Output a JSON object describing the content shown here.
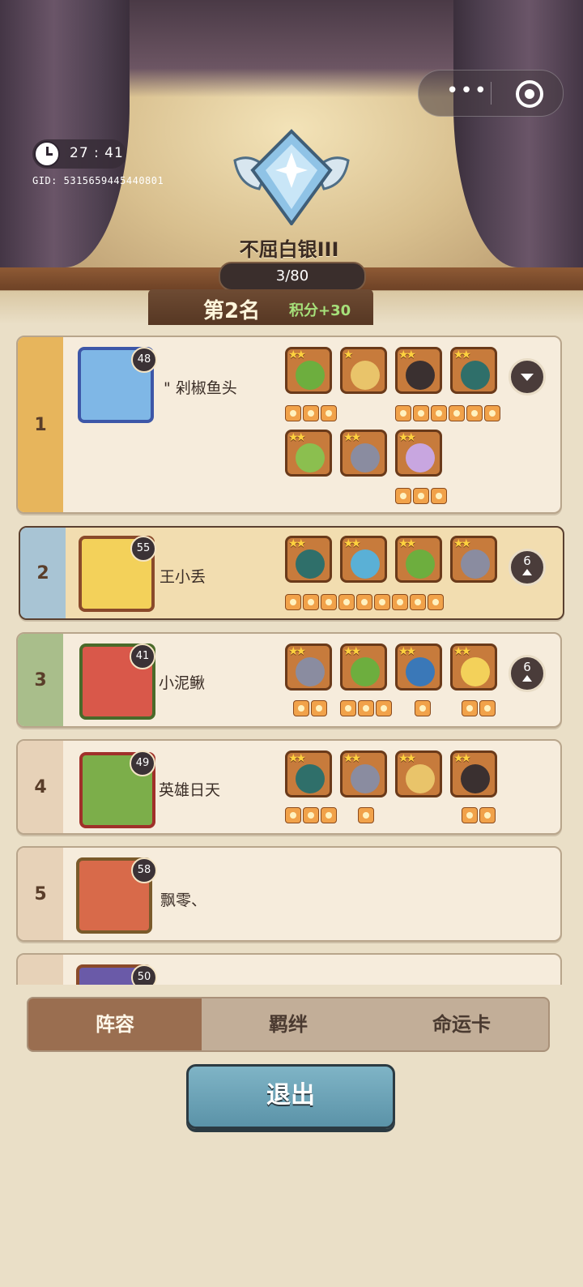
{
  "header": {
    "menu_dots": "•••",
    "timer": "27 : 41",
    "gid": "GID: 5315659445440801",
    "rank_title": "不屈白银III",
    "rank_progress": "3/80",
    "place": "第2名",
    "score": "积分+30"
  },
  "players": [
    {
      "rank": "1",
      "level": "48",
      "name": "\" 剁椒鱼头",
      "avatar_color": "#7fb7e6"
    },
    {
      "rank": "2",
      "level": "55",
      "name": "王小丢",
      "avatar_color": "#f3d15a",
      "expand_count": "6"
    },
    {
      "rank": "3",
      "level": "41",
      "name": "小泥鳅",
      "avatar_color": "#d9584a",
      "expand_count": "6"
    },
    {
      "rank": "4",
      "level": "49",
      "name": "英雄日天",
      "avatar_color": "#7cae4a"
    },
    {
      "rank": "5",
      "level": "58",
      "name": "飘零、",
      "avatar_color": "#d86a4a"
    },
    {
      "rank": "",
      "level": "50",
      "name": "",
      "avatar_color": "#6a5aa8"
    }
  ],
  "tabs": [
    "阵容",
    "羁绊",
    "命运卡"
  ],
  "active_tab": "阵容",
  "exit_label": "退出",
  "colors": {
    "accent": "#9a6e50",
    "exit_button": "#6fa5ba",
    "score_green": "#a6e07a"
  }
}
